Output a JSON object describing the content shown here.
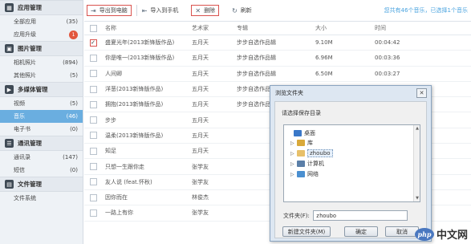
{
  "sidebar": {
    "sections": [
      {
        "title": "应用管理",
        "icon": "apps-icon",
        "items": [
          {
            "label": "全部应用",
            "count": "(35)",
            "active": false
          },
          {
            "label": "应用升级",
            "count": "1",
            "badge": true,
            "active": false
          }
        ]
      },
      {
        "title": "图片管理",
        "icon": "image-icon",
        "items": [
          {
            "label": "相机照片",
            "count": "(894)",
            "active": false
          },
          {
            "label": "其他照片",
            "count": "(5)",
            "active": false
          }
        ]
      },
      {
        "title": "多媒体管理",
        "icon": "media-icon",
        "items": [
          {
            "label": "视频",
            "count": "(5)",
            "active": false
          },
          {
            "label": "音乐",
            "count": "(46)",
            "active": true
          },
          {
            "label": "电子书",
            "count": "(0)",
            "active": false
          }
        ]
      },
      {
        "title": "通讯管理",
        "icon": "contacts-icon",
        "items": [
          {
            "label": "通讯录",
            "count": "(147)",
            "active": false
          },
          {
            "label": "短信",
            "count": "(0)",
            "active": false
          }
        ]
      },
      {
        "title": "文件管理",
        "icon": "file-icon",
        "items": [
          {
            "label": "文件系统",
            "count": "",
            "active": false
          }
        ]
      }
    ]
  },
  "toolbar": {
    "export_label": "导出到电脑",
    "import_label": "导入到手机",
    "delete_label": "删除",
    "refresh_label": "刷新",
    "info": "您共有46个音乐，已选择1个音乐"
  },
  "table": {
    "headers": {
      "name": "名称",
      "artist": "艺术家",
      "album": "专辑",
      "size": "大小",
      "time": "时间"
    },
    "rows": [
      {
        "checked": true,
        "name": "盛夏光年(2013新锋版作品)",
        "artist": "五月天",
        "album": "步步自选作品辑",
        "size": "9.10M",
        "time": "00:04:42"
      },
      {
        "checked": false,
        "name": "你是唯一(2013新锋版作品)",
        "artist": "五月天",
        "album": "步步自选作品辑",
        "size": "6.96M",
        "time": "00:03:36"
      },
      {
        "checked": false,
        "name": "人间卿",
        "artist": "五月天",
        "album": "步步自选作品辑",
        "size": "6.50M",
        "time": "00:03:27"
      },
      {
        "checked": false,
        "name": "洋葱(2013新锋版作品)",
        "artist": "五月天",
        "album": "步步自选作品辑",
        "size": "",
        "time": ""
      },
      {
        "checked": false,
        "name": "拥抱(2013新锋版作品)",
        "artist": "五月天",
        "album": "步步自选作品辑",
        "size": "",
        "time": ""
      },
      {
        "checked": false,
        "name": "步步",
        "artist": "五月天",
        "album": "",
        "size": "",
        "time": ""
      },
      {
        "checked": false,
        "name": "温柔(2013新锋版作品)",
        "artist": "五月天",
        "album": "",
        "size": "",
        "time": ""
      },
      {
        "checked": false,
        "name": "知足",
        "artist": "五月天",
        "album": "",
        "size": "",
        "time": ""
      },
      {
        "checked": false,
        "name": "只想一生跟你走",
        "artist": "张学友",
        "album": "",
        "size": "",
        "time": ""
      },
      {
        "checked": false,
        "name": "友人说 (feat.怀秋)",
        "artist": "张学友",
        "album": "",
        "size": "",
        "time": ""
      },
      {
        "checked": false,
        "name": "因你而在",
        "artist": "林俊杰",
        "album": "",
        "size": "",
        "time": ""
      },
      {
        "checked": false,
        "name": "一路上有你",
        "artist": "张学友",
        "album": "",
        "size": "",
        "time": ""
      }
    ]
  },
  "dialog": {
    "title": "浏览文件夹",
    "close": "✕",
    "prompt": "请选择保存目录",
    "tree": [
      {
        "label": "桌面",
        "icon": "desktop-icon",
        "color": "#3a78c8",
        "arrow": "",
        "level": 0
      },
      {
        "label": "库",
        "icon": "library-icon",
        "color": "#d9a93a",
        "arrow": "▷",
        "level": 1
      },
      {
        "label": "zhoubo",
        "icon": "user-folder-icon",
        "color": "#e7c06a",
        "arrow": "▷",
        "level": 1,
        "selected": true
      },
      {
        "label": "计算机",
        "icon": "computer-icon",
        "color": "#5b7fa8",
        "arrow": "▷",
        "level": 1
      },
      {
        "label": "网络",
        "icon": "network-icon",
        "color": "#4a8fd0",
        "arrow": "▷",
        "level": 1
      }
    ],
    "folder_label": "文件夹(F):",
    "folder_value": "zhoubo",
    "new_folder_label": "新建文件夹(M)",
    "ok_label": "确定",
    "cancel_label": "取消"
  },
  "watermark": {
    "logo": "php",
    "text": "中文网"
  }
}
